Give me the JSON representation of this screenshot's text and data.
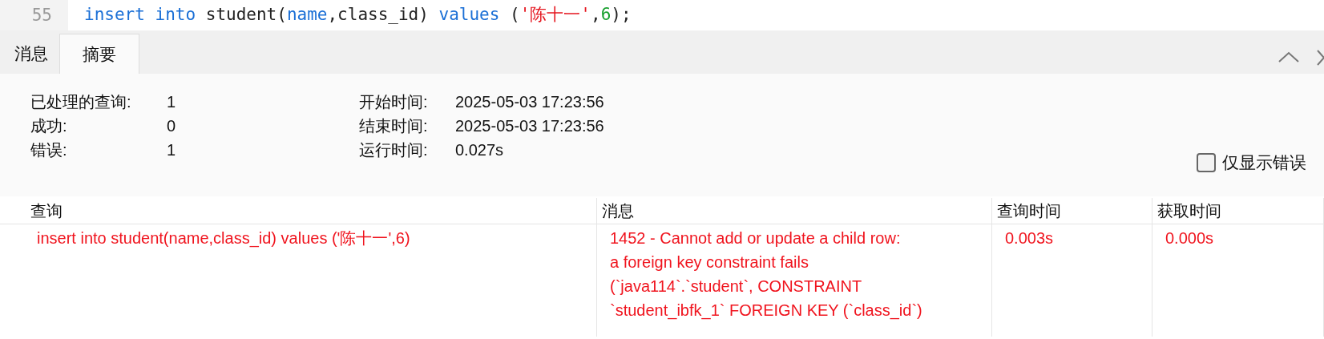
{
  "editor": {
    "line_number": "55",
    "tokens": [
      {
        "text": "insert ",
        "kind": "keyword"
      },
      {
        "text": "into",
        "kind": "keyword"
      },
      {
        "text": " student(",
        "kind": "plain"
      },
      {
        "text": "name",
        "kind": "keyword"
      },
      {
        "text": ",class_id) ",
        "kind": "plain"
      },
      {
        "text": "values",
        "kind": "keyword"
      },
      {
        "text": " (",
        "kind": "plain"
      },
      {
        "text": "'陈十一'",
        "kind": "string"
      },
      {
        "text": ",",
        "kind": "plain"
      },
      {
        "text": "6",
        "kind": "number"
      },
      {
        "text": ");",
        "kind": "plain"
      }
    ]
  },
  "tabs": [
    {
      "label": "消息",
      "selected": false
    },
    {
      "label": "摘要",
      "selected": true
    }
  ],
  "summary": {
    "left": [
      {
        "label": "已处理的查询:",
        "value": "1"
      },
      {
        "label": "成功:",
        "value": "0"
      },
      {
        "label": "错误:",
        "value": "1"
      }
    ],
    "right": [
      {
        "label": "开始时间:",
        "value": "2025-05-03 17:23:56"
      },
      {
        "label": "结束时间:",
        "value": "2025-05-03 17:23:56"
      },
      {
        "label": "运行时间:",
        "value": "0.027s"
      }
    ],
    "errors_only": {
      "label": "仅显示错误",
      "checked": false
    }
  },
  "table": {
    "columns": [
      "查询",
      "消息",
      "查询时间",
      "获取时间"
    ],
    "rows": [
      {
        "error": true,
        "cells": [
          "insert into student(name,class_id) values ('陈十一',6)",
          "1452 - Cannot add or update a child row:\na foreign key constraint fails\n(`java114`.`student`, CONSTRAINT\n`student_ibfk_1` FOREIGN KEY (`class_id`)",
          "0.003s",
          "0.000s"
        ]
      }
    ]
  }
}
